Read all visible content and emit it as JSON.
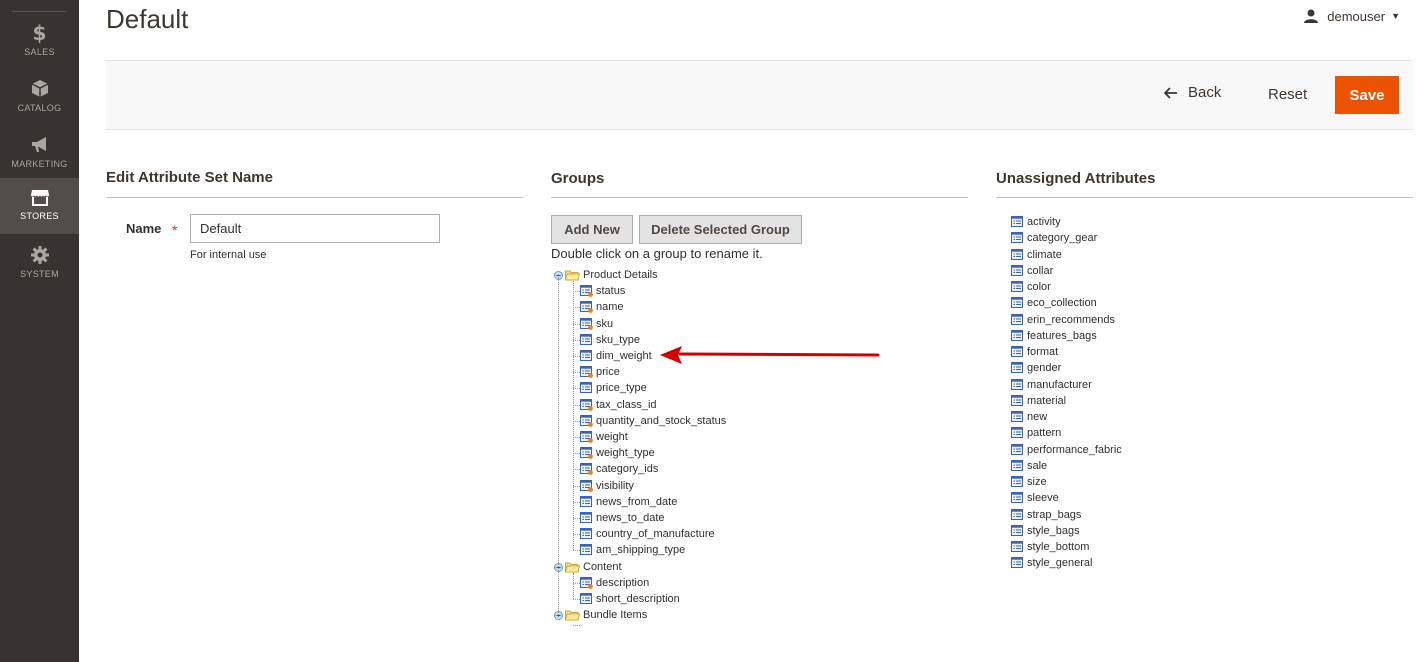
{
  "sidebar": {
    "items": [
      {
        "label": "SALES",
        "icon": "dollar-icon"
      },
      {
        "label": "CATALOG",
        "icon": "box-icon"
      },
      {
        "label": "MARKETING",
        "icon": "megaphone-icon"
      },
      {
        "label": "STORES",
        "icon": "store-icon"
      },
      {
        "label": "SYSTEM",
        "icon": "gear-icon"
      }
    ],
    "active": "STORES"
  },
  "header": {
    "title": "Default",
    "user": "demouser"
  },
  "actions": {
    "back": "Back",
    "reset": "Reset",
    "save": "Save"
  },
  "edit_name": {
    "title": "Edit Attribute Set Name",
    "label": "Name",
    "value": "Default",
    "note": "For internal use"
  },
  "groups": {
    "title": "Groups",
    "add_new": "Add New",
    "delete_group": "Delete Selected Group",
    "hint": "Double click on a group to rename it.",
    "tree": [
      {
        "name": "Product Details",
        "attributes": [
          "status",
          "name",
          "sku",
          "sku_type",
          "dim_weight",
          "price",
          "price_type",
          "tax_class_id",
          "quantity_and_stock_status",
          "weight",
          "weight_type",
          "category_ids",
          "visibility",
          "news_from_date",
          "news_to_date",
          "country_of_manufacture",
          "am_shipping_type"
        ],
        "system_flags": [
          true,
          true,
          true,
          false,
          false,
          true,
          false,
          true,
          true,
          true,
          true,
          true,
          true,
          false,
          false,
          false,
          false
        ]
      },
      {
        "name": "Content",
        "attributes": [
          "description",
          "short_description"
        ],
        "system_flags": [
          true,
          false
        ]
      },
      {
        "name": "Bundle Items",
        "attributes": [],
        "system_flags": []
      }
    ]
  },
  "unassigned": {
    "title": "Unassigned Attributes",
    "attributes": [
      "activity",
      "category_gear",
      "climate",
      "collar",
      "color",
      "eco_collection",
      "erin_recommends",
      "features_bags",
      "format",
      "gender",
      "manufacturer",
      "material",
      "new",
      "pattern",
      "performance_fabric",
      "sale",
      "size",
      "sleeve",
      "strap_bags",
      "style_bags",
      "style_bottom",
      "style_general"
    ]
  },
  "colors": {
    "sidebar_bg": "#373330",
    "sidebar_active": "#524d49",
    "save_button": "#eb5202",
    "annotation_arrow": "#d40000"
  }
}
